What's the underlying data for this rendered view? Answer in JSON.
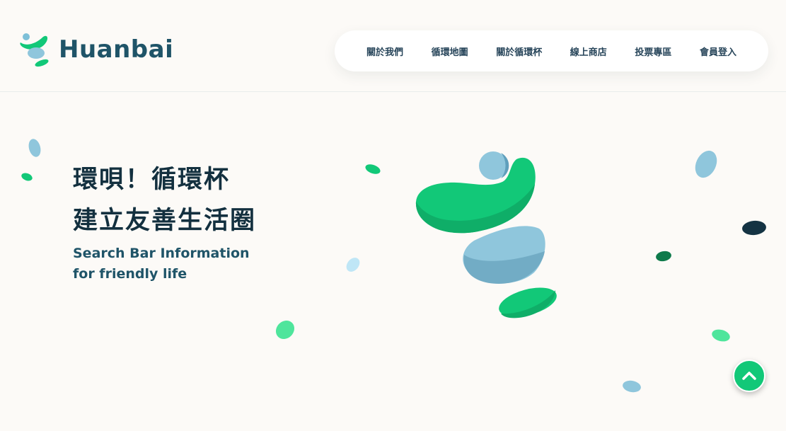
{
  "brand": {
    "name": "Huanbai",
    "logo_icon": "huanbai-logo-icon"
  },
  "nav": {
    "items": [
      {
        "label": "關於我們"
      },
      {
        "label": "循環地圖"
      },
      {
        "label": "關於循環杯"
      },
      {
        "label": "線上商店"
      },
      {
        "label": "投票專區"
      },
      {
        "label": "會員登入"
      }
    ]
  },
  "hero": {
    "title_line1": "環唄！循環杯",
    "title_line2": "建立友善生活圈",
    "subtitle_line1": "Search Bar Information",
    "subtitle_line2": "for friendly life"
  },
  "scroll_top": {
    "icon": "chevron-up-icon"
  },
  "colors": {
    "brand_dark": "#1f5468",
    "accent_green": "#12c878",
    "light_blue": "#8fc6dc",
    "dark_navy": "#13303f"
  }
}
